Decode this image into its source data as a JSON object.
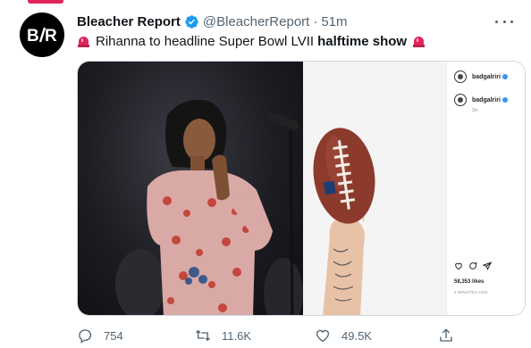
{
  "tweet": {
    "author_name": "Bleacher Report",
    "author_handle": "@BleacherReport",
    "separator": "·",
    "time": "51m",
    "text_main": "Rihanna to headline Super Bowl LVII",
    "text_bold": "halftime show",
    "avatar_initials": "B/R"
  },
  "instagram_post": {
    "username_top": "badgalriri",
    "username_comment": "badgalriri",
    "comment_time": "2m",
    "likes": "58,353 likes",
    "posted_ago": "2 MINUTES AGO"
  },
  "actions": {
    "replies": "754",
    "retweets": "11.6K",
    "likes": "49.5K"
  },
  "colors": {
    "verified": "#1d9bf0",
    "muted_text": "#536471",
    "siren": "#e0245e"
  },
  "icons": [
    "verified-icon",
    "more-icon",
    "siren-icon",
    "reply-icon",
    "retweet-icon",
    "like-icon",
    "share-icon"
  ]
}
